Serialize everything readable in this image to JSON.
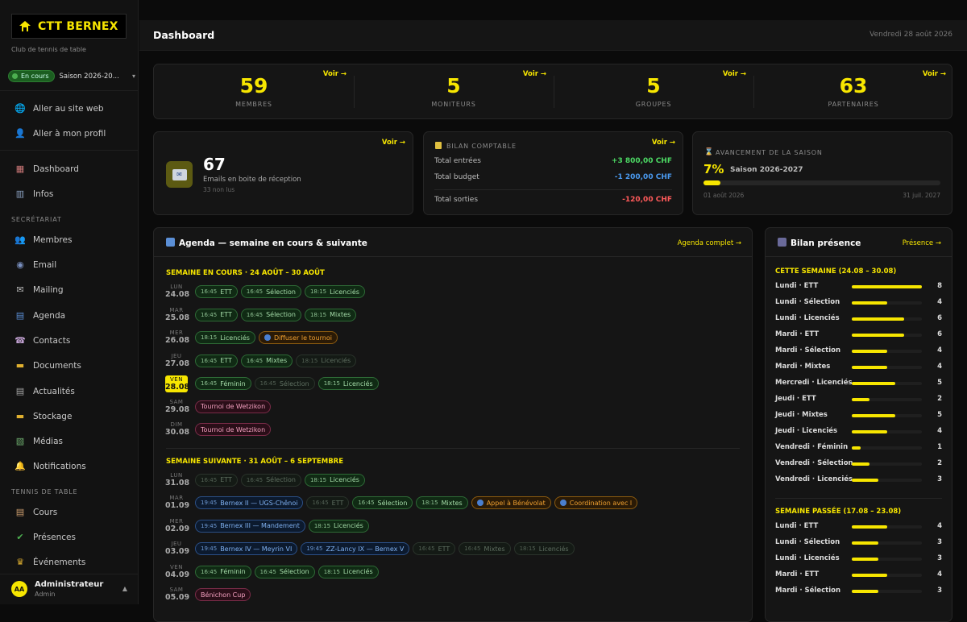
{
  "sidebar": {
    "brand": "CTT BERNEX",
    "subtitle": "Club de tennis de table",
    "season_badge": "En cours",
    "season_label": "Saison 2026-20...",
    "links": [
      {
        "label": "Aller au site web",
        "icon": "globe-icon"
      },
      {
        "label": "Aller à mon profil",
        "icon": "user-icon"
      }
    ],
    "main_items": [
      {
        "label": "Dashboard",
        "icon": "chart-icon"
      },
      {
        "label": "Infos",
        "icon": "building-icon"
      }
    ],
    "section_secretariat": "SECRÉTARIAT",
    "secretariat_items": [
      {
        "label": "Membres",
        "icon": "users-icon"
      },
      {
        "label": "Email",
        "icon": "email-icon"
      },
      {
        "label": "Mailing",
        "icon": "mailing-icon"
      },
      {
        "label": "Agenda",
        "icon": "calendar-icon"
      },
      {
        "label": "Contacts",
        "icon": "contacts-icon"
      },
      {
        "label": "Documents",
        "icon": "folder-icon"
      },
      {
        "label": "Actualités",
        "icon": "news-icon"
      },
      {
        "label": "Stockage",
        "icon": "storage-icon"
      },
      {
        "label": "Médias",
        "icon": "image-icon"
      },
      {
        "label": "Notifications",
        "icon": "bell-icon"
      }
    ],
    "section_tennis": "TENNIS DE TABLE",
    "tennis_items": [
      {
        "label": "Cours",
        "icon": "clipboard-icon"
      },
      {
        "label": "Présences",
        "icon": "check-icon"
      },
      {
        "label": "Événements",
        "icon": "trophy-icon"
      }
    ],
    "user": {
      "initials": "AA",
      "name": "Administrateur",
      "role": "Admin"
    }
  },
  "header": {
    "title": "Dashboard",
    "date": "Vendredi 28 août 2026"
  },
  "stats": [
    {
      "value": "59",
      "label": "MEMBRES",
      "link": "Voir →"
    },
    {
      "value": "5",
      "label": "MONITEURS",
      "link": "Voir →"
    },
    {
      "value": "5",
      "label": "GROUPES",
      "link": "Voir →"
    },
    {
      "value": "63",
      "label": "PARTENAIRES",
      "link": "Voir →"
    }
  ],
  "emails": {
    "count": "67",
    "label": "Emails en boite de réception",
    "unread": "33 non lus",
    "link": "Voir →"
  },
  "bilan": {
    "title": "BILAN COMPTABLE",
    "link": "Voir →",
    "rows": [
      {
        "label": "Total entrées",
        "value": "+3 800,00 CHF",
        "color": "#4cd964"
      },
      {
        "label": "Total budget",
        "value": "-1 200,00 CHF",
        "color": "#4a9af0"
      },
      {
        "label": "Total sorties",
        "value": "-120,00 CHF",
        "color": "#ff5a5a"
      }
    ]
  },
  "avancement": {
    "title": "AVANCEMENT DE LA SAISON",
    "percent_label": "7%",
    "percent": 0.07,
    "season": "Saison 2026-2027",
    "start": "01 août 2026",
    "end": "31 juil. 2027"
  },
  "agenda": {
    "title": "Agenda — semaine en cours & suivante",
    "link": "Agenda complet →",
    "weeks": [
      {
        "title": "SEMAINE EN COURS · 24 AOÛT – 30 AOÛT",
        "days": [
          {
            "dn": "LUN",
            "dd": "24.08",
            "chips": [
              {
                "t": "16:45",
                "l": "ETT",
                "k": "g"
              },
              {
                "t": "16:45",
                "l": "Sélection",
                "k": "g"
              },
              {
                "t": "18:15",
                "l": "Licenciés",
                "k": "g"
              }
            ]
          },
          {
            "dn": "MAR",
            "dd": "25.08",
            "chips": [
              {
                "t": "16:45",
                "l": "ETT",
                "k": "g"
              },
              {
                "t": "16:45",
                "l": "Sélection",
                "k": "g"
              },
              {
                "t": "18:15",
                "l": "Mixtes",
                "k": "g"
              }
            ]
          },
          {
            "dn": "MER",
            "dd": "26.08",
            "chips": [
              {
                "t": "18:15",
                "l": "Licenciés",
                "k": "g"
              },
              {
                "t": "",
                "l": "Diffuser le tournoi",
                "k": "o",
                "globe": true
              }
            ]
          },
          {
            "dn": "JEU",
            "dd": "27.08",
            "chips": [
              {
                "t": "16:45",
                "l": "ETT",
                "k": "g"
              },
              {
                "t": "16:45",
                "l": "Mixtes",
                "k": "g"
              },
              {
                "t": "18:15",
                "l": "Licenciés",
                "k": "gd"
              }
            ]
          },
          {
            "dn": "VEN",
            "dd": "28.08",
            "today": true,
            "chips": [
              {
                "t": "16:45",
                "l": "Féminin",
                "k": "g"
              },
              {
                "t": "16:45",
                "l": "Sélection",
                "k": "gd"
              },
              {
                "t": "18:15",
                "l": "Licenciés",
                "k": "g"
              }
            ]
          },
          {
            "dn": "SAM",
            "dd": "29.08",
            "chips": [
              {
                "t": "",
                "l": "Tournoi de Wetzikon",
                "k": "p"
              }
            ]
          },
          {
            "dn": "DIM",
            "dd": "30.08",
            "chips": [
              {
                "t": "",
                "l": "Tournoi de Wetzikon",
                "k": "p"
              }
            ]
          }
        ]
      },
      {
        "title": "SEMAINE SUIVANTE · 31 AOÛT – 6 SEPTEMBRE",
        "days": [
          {
            "dn": "LUN",
            "dd": "31.08",
            "chips": [
              {
                "t": "16:45",
                "l": "ETT",
                "k": "gd"
              },
              {
                "t": "16:45",
                "l": "Sélection",
                "k": "gd"
              },
              {
                "t": "18:15",
                "l": "Licenciés",
                "k": "g"
              }
            ]
          },
          {
            "dn": "MAR",
            "dd": "01.09",
            "chips": [
              {
                "t": "19:45",
                "l": "Bernex II — UGS-Chênoi",
                "k": "b"
              },
              {
                "t": "16:45",
                "l": "ETT",
                "k": "gd"
              },
              {
                "t": "16:45",
                "l": "Sélection",
                "k": "g"
              },
              {
                "t": "18:15",
                "l": "Mixtes",
                "k": "g"
              },
              {
                "t": "",
                "l": "Appel à Bénévolat",
                "k": "o",
                "globe": true
              },
              {
                "t": "",
                "l": "Coordination avec l",
                "k": "o",
                "globe": true
              }
            ]
          },
          {
            "dn": "MER",
            "dd": "02.09",
            "chips": [
              {
                "t": "19:45",
                "l": "Bernex III — Mandement",
                "k": "b"
              },
              {
                "t": "18:15",
                "l": "Licenciés",
                "k": "g"
              }
            ]
          },
          {
            "dn": "JEU",
            "dd": "03.09",
            "chips": [
              {
                "t": "19:45",
                "l": "Bernex IV — Meyrin VI",
                "k": "b"
              },
              {
                "t": "19:45",
                "l": "ZZ-Lancy IX — Bernex V",
                "k": "b"
              },
              {
                "t": "16:45",
                "l": "ETT",
                "k": "gd"
              },
              {
                "t": "16:45",
                "l": "Mixtes",
                "k": "gd"
              },
              {
                "t": "18:15",
                "l": "Licenciés",
                "k": "gd"
              }
            ]
          },
          {
            "dn": "VEN",
            "dd": "04.09",
            "chips": [
              {
                "t": "16:45",
                "l": "Féminin",
                "k": "g"
              },
              {
                "t": "16:45",
                "l": "Sélection",
                "k": "g"
              },
              {
                "t": "18:15",
                "l": "Licenciés",
                "k": "g"
              }
            ]
          },
          {
            "dn": "SAM",
            "dd": "05.09",
            "chips": [
              {
                "t": "",
                "l": "Bénichon Cup",
                "k": "p"
              }
            ]
          }
        ]
      }
    ]
  },
  "presence": {
    "title": "Bilan présence",
    "link": "Présence →",
    "max": 8,
    "sections": [
      {
        "title": "CETTE SEMAINE (24.08 – 30.08)",
        "rows": [
          {
            "l": "Lundi · ETT",
            "v": 8
          },
          {
            "l": "Lundi · Sélection",
            "v": 4
          },
          {
            "l": "Lundi · Licenciés",
            "v": 6
          },
          {
            "l": "Mardi · ETT",
            "v": 6
          },
          {
            "l": "Mardi · Sélection",
            "v": 4
          },
          {
            "l": "Mardi · Mixtes",
            "v": 4
          },
          {
            "l": "Mercredi · Licenciés",
            "v": 5
          },
          {
            "l": "Jeudi · ETT",
            "v": 2
          },
          {
            "l": "Jeudi · Mixtes",
            "v": 5
          },
          {
            "l": "Jeudi · Licenciés",
            "v": 4
          },
          {
            "l": "Vendredi · Féminin",
            "v": 1
          },
          {
            "l": "Vendredi · Sélection",
            "v": 2
          },
          {
            "l": "Vendredi · Licenciés",
            "v": 3
          }
        ]
      },
      {
        "title": "SEMAINE PASSÉE (17.08 – 23.08)",
        "rows": [
          {
            "l": "Lundi · ETT",
            "v": 4
          },
          {
            "l": "Lundi · Sélection",
            "v": 3
          },
          {
            "l": "Lundi · Licenciés",
            "v": 3
          },
          {
            "l": "Mardi · ETT",
            "v": 4
          },
          {
            "l": "Mardi · Sélection",
            "v": 3
          }
        ]
      }
    ]
  }
}
